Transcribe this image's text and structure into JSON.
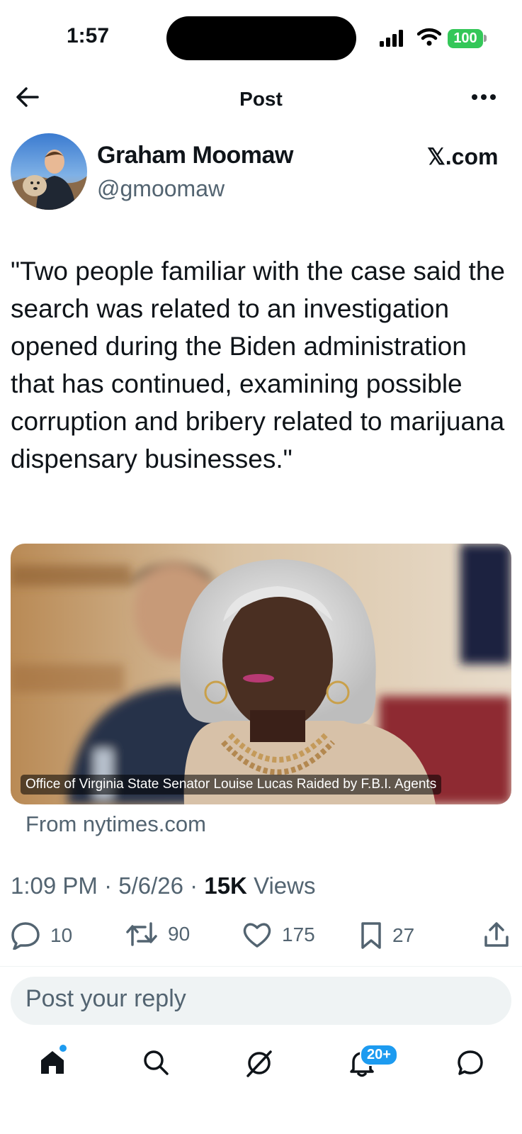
{
  "status": {
    "time": "1:57",
    "battery": "100"
  },
  "nav": {
    "title": "Post"
  },
  "author": {
    "name": "Graham Moomaw",
    "handle": "@gmoomaw",
    "source": "𝕏.com"
  },
  "post": {
    "text": "\"Two people familiar with the case said the search was related to an investigation opened during the Biden administration that has continued, examining possible corruption and bribery related to marijuana dispensary businesses.\""
  },
  "card": {
    "caption": "Office of Virginia State Senator Louise Lucas Raided by F.B.I. Agents",
    "from": "From nytimes.com"
  },
  "meta": {
    "time": "1:09 PM",
    "date": "5/6/26",
    "views_count": "15K",
    "views_label": "Views",
    "sep": "·"
  },
  "actions": {
    "replies": "10",
    "reposts": "90",
    "likes": "175",
    "bookmarks": "27"
  },
  "reply": {
    "placeholder": "Post your reply"
  },
  "tabbar": {
    "notifications_badge": "20+"
  },
  "colors": {
    "accent": "#1d9bf0",
    "text": "#0f1419",
    "secondary": "#536471",
    "battery": "#34c759"
  },
  "icons": [
    "back-arrow-icon",
    "more-icon",
    "reply-icon",
    "repost-icon",
    "like-icon",
    "bookmark-icon",
    "share-icon",
    "home-icon",
    "search-icon",
    "grok-icon",
    "bell-icon",
    "messages-icon"
  ]
}
